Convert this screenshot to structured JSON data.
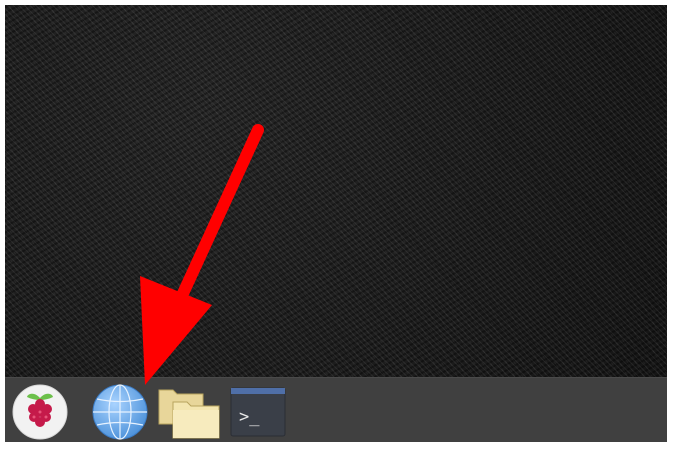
{
  "desktop": {
    "wallpaper": "dark-textured"
  },
  "taskbar": {
    "background": "#404040",
    "items": [
      {
        "name": "raspberry-pi-menu",
        "icon": "raspberry-icon"
      },
      {
        "name": "web-browser",
        "icon": "globe-icon"
      },
      {
        "name": "file-manager",
        "icon": "folder-icon"
      },
      {
        "name": "terminal",
        "icon": "terminal-icon",
        "prompt_text": ">_"
      }
    ]
  },
  "annotation": {
    "icon": "red-arrow-icon",
    "color": "#ff0000",
    "points_to": "web-browser"
  }
}
